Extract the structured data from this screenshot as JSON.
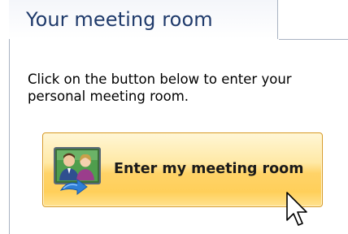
{
  "tab": {
    "title": "Your meeting room"
  },
  "instructions": {
    "text": "Click on the button below to enter your personal meeting room."
  },
  "enter_button": {
    "label": "Enter my meeting room",
    "icon": "meeting-room-icon"
  },
  "colors": {
    "tab_title": "#1f3a6b",
    "border": "#a9b3c2",
    "button_border": "#d79b2a",
    "button_fill": "#ffd368"
  },
  "cursor": {
    "icon": "mouse-pointer-icon"
  }
}
